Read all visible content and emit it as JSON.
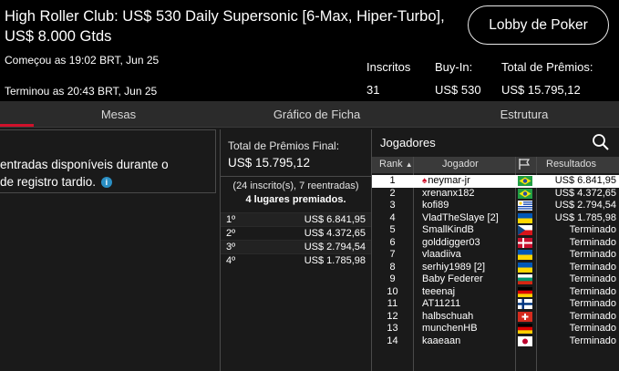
{
  "header": {
    "title": "High Roller Club: US$ 530 Daily Supersonic [6-Max, Hiper-Turbo], US$ 8.000 Gtds",
    "lobby_button": "Lobby de Poker",
    "started": "Começou as 19:02 BRT, Jun 25",
    "ended": "Terminou as 20:43 BRT, Jun 25",
    "stats": [
      {
        "label": "Inscritos",
        "value": "31"
      },
      {
        "label": "Buy-In:",
        "value": "US$ 530"
      },
      {
        "label": "Total de Prêmios:",
        "value": "US$ 15.795,12"
      }
    ]
  },
  "tabs": [
    "Mesas",
    "Gráfico de Ficha",
    "Estrutura"
  ],
  "left": {
    "line1": "entradas disponíveis durante o",
    "line2": "de registro tardio."
  },
  "prizes": {
    "heading": "Total de Prêmios Final:",
    "total": "US$ 15.795,12",
    "entries": "(24 inscrito(s), 7 reentradas)",
    "places": "4 lugares premiados.",
    "rows": [
      {
        "pos": "1º",
        "amount": "US$ 6.841,95"
      },
      {
        "pos": "2º",
        "amount": "US$ 4.372,65"
      },
      {
        "pos": "3º",
        "amount": "US$ 2.794,54"
      },
      {
        "pos": "4º",
        "amount": "US$ 1.785,98"
      }
    ]
  },
  "players": {
    "label": "Jogadores",
    "columns": [
      "Rank",
      "Jogador",
      "Resultados"
    ],
    "rows": [
      {
        "rank": "1",
        "name": "neymar-jr",
        "flag": "brazil",
        "result": "US$ 6.841,95"
      },
      {
        "rank": "2",
        "name": "xrenanx182",
        "flag": "brazil",
        "result": "US$ 4.372,65"
      },
      {
        "rank": "3",
        "name": "kofi89",
        "flag": "uruguay",
        "result": "US$ 2.794,54"
      },
      {
        "rank": "4",
        "name": "VladTheSlaye [2]",
        "flag": "ukraine",
        "result": "US$ 1.785,98"
      },
      {
        "rank": "5",
        "name": "SmallKindB",
        "flag": "czech",
        "result": "Terminado"
      },
      {
        "rank": "6",
        "name": "golddigger03",
        "flag": "denmark",
        "result": "Terminado"
      },
      {
        "rank": "7",
        "name": "vlaadiiva",
        "flag": "ukraine",
        "result": "Terminado"
      },
      {
        "rank": "8",
        "name": "serhiy1989 [2]",
        "flag": "ukraine",
        "result": "Terminado"
      },
      {
        "rank": "9",
        "name": "Baby Federer",
        "flag": "bulgaria",
        "result": "Terminado"
      },
      {
        "rank": "10",
        "name": "teeenaj",
        "flag": "germany",
        "result": "Terminado"
      },
      {
        "rank": "11",
        "name": "AT11211",
        "flag": "finland",
        "result": "Terminado"
      },
      {
        "rank": "12",
        "name": "halbschuah",
        "flag": "switzerland",
        "result": "Terminado"
      },
      {
        "rank": "13",
        "name": "munchenHB",
        "flag": "germany",
        "result": "Terminado"
      },
      {
        "rank": "14",
        "name": "kaaeaan",
        "flag": "japan",
        "result": "Terminado"
      }
    ]
  },
  "colors": {
    "accent": "#d0112b",
    "info": "#2a8fc4"
  }
}
